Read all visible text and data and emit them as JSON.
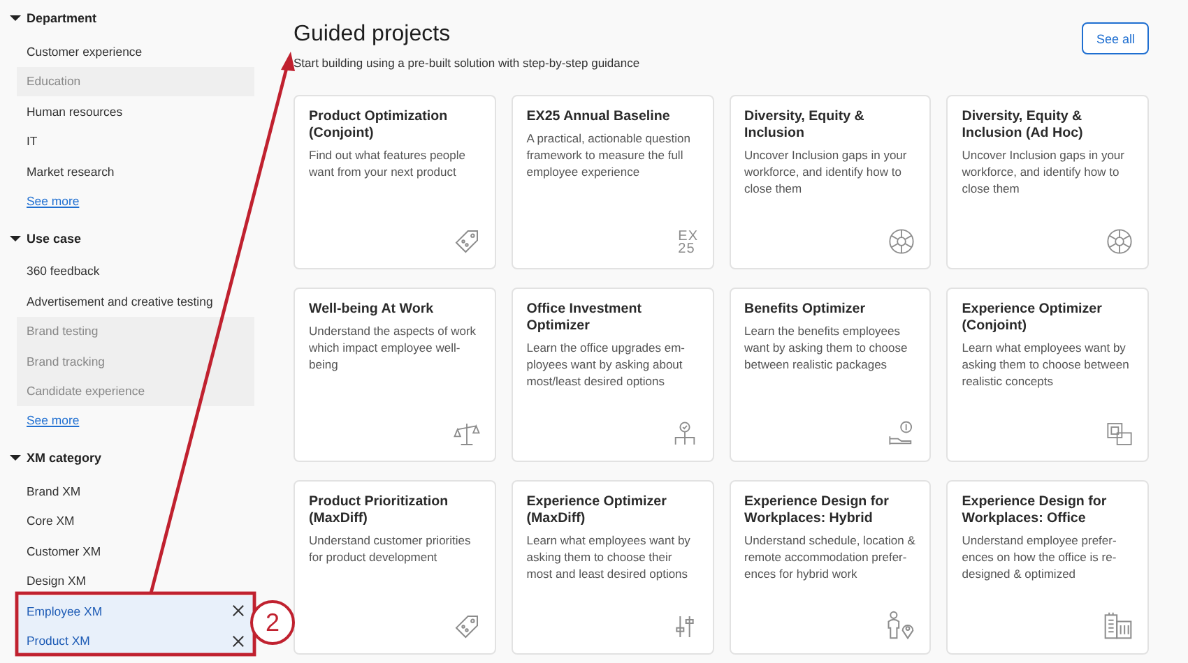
{
  "sidebar": {
    "groups": [
      {
        "title": "Department",
        "expanded": true,
        "items": [
          {
            "label": "Customer experience",
            "disabled": false,
            "selected": false
          },
          {
            "label": "Education",
            "disabled": true,
            "selected": false
          },
          {
            "label": "Human resources",
            "disabled": false,
            "selected": false
          },
          {
            "label": "IT",
            "disabled": false,
            "selected": false
          },
          {
            "label": "Market research",
            "disabled": false,
            "selected": false
          }
        ],
        "see_more": "See more"
      },
      {
        "title": "Use case",
        "expanded": true,
        "items": [
          {
            "label": "360 feedback",
            "disabled": false,
            "selected": false
          },
          {
            "label": "Advertisement and creative testing",
            "disabled": false,
            "selected": false
          },
          {
            "label": "Brand testing",
            "disabled": true,
            "selected": false
          },
          {
            "label": "Brand tracking",
            "disabled": true,
            "selected": false
          },
          {
            "label": "Candidate experience",
            "disabled": true,
            "selected": false
          }
        ],
        "see_more": "See more"
      },
      {
        "title": "XM category",
        "expanded": true,
        "items": [
          {
            "label": "Brand XM",
            "disabled": false,
            "selected": false
          },
          {
            "label": "Core XM",
            "disabled": false,
            "selected": false
          },
          {
            "label": "Customer XM",
            "disabled": false,
            "selected": false
          },
          {
            "label": "Design XM",
            "disabled": false,
            "selected": false
          },
          {
            "label": "Employee XM",
            "disabled": false,
            "selected": true
          },
          {
            "label": "Product XM",
            "disabled": false,
            "selected": true
          }
        ]
      }
    ]
  },
  "main": {
    "title": "Guided projects",
    "subtitle": "Start building using a pre-built solution with step-by-step guidance",
    "see_all": "See all",
    "cards": [
      {
        "title": "Product Optimization (Conjoint)",
        "description": "Find out what features people want from your next product",
        "kind": "tag"
      },
      {
        "title": "EX25 Annual Baseline",
        "description": "A practical, actionable question framework to measure the full employee experience",
        "kind": "ex25",
        "icon_lines": [
          "EX",
          "25"
        ]
      },
      {
        "title": "Diversity, Equity & Inclusion",
        "description": "Uncover Inclusion gaps in your workforce, and identify how to close them",
        "kind": "wheel"
      },
      {
        "title": "Diversity, Equity & Inclusion (Ad Hoc)",
        "description": "Uncover Inclusion gaps in your workforce, and identify how to close them",
        "kind": "wheel"
      },
      {
        "title": "Well-being At Work",
        "description": "Understand the aspects of work which impact employee well-being",
        "kind": "scale"
      },
      {
        "title": "Office Investment Optimizer",
        "description": "Learn the office upgrades em-ployees want by asking about most/least desired options",
        "kind": "org"
      },
      {
        "title": "Benefits Optimizer",
        "description": "Learn the benefits employees want by asking them to choose between realistic packages",
        "kind": "money"
      },
      {
        "title": "Experience Optimizer (Conjoint)",
        "description": "Learn what employees want by asking them to choose between realistic concepts",
        "kind": "layout"
      },
      {
        "title": "Product Prioritization (MaxDiff)",
        "description": "Understand customer priorities for product development",
        "kind": "tag"
      },
      {
        "title": "Experience Optimizer (MaxDiff)",
        "description": "Learn what employees want by asking them to choose their most and least desired options",
        "kind": "sliders"
      },
      {
        "title": "Experience Design for Workplaces: Hybrid",
        "description": "Understand schedule, location & remote accommodation prefer-ences for hybrid work",
        "kind": "person-pin"
      },
      {
        "title": "Experience Design for Workplaces: Office",
        "description": "Understand employee prefer-ences on how the office is re-designed & optimized",
        "kind": "buildings"
      }
    ]
  },
  "annotation": {
    "step": "2"
  }
}
